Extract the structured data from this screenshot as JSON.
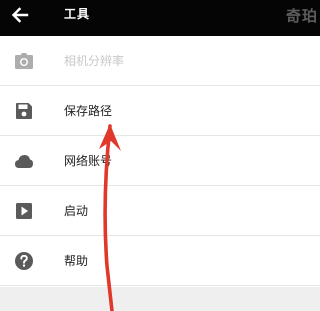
{
  "appbar": {
    "back_icon": "arrow-left-icon",
    "title": "工具",
    "watermark": "奇珀"
  },
  "menu": {
    "items": [
      {
        "label": "相机分辨率",
        "icon": "camera-icon",
        "enabled": false
      },
      {
        "label": "保存路径",
        "icon": "floppy-disk-icon",
        "enabled": true
      },
      {
        "label": "网络账号",
        "icon": "cloud-icon",
        "enabled": true
      },
      {
        "label": "启动",
        "icon": "play-icon",
        "enabled": true
      },
      {
        "label": "帮助",
        "icon": "help-icon",
        "enabled": true
      }
    ]
  },
  "annotation": {
    "arrow_color": "#e0392b",
    "points_to": "保存路径"
  }
}
